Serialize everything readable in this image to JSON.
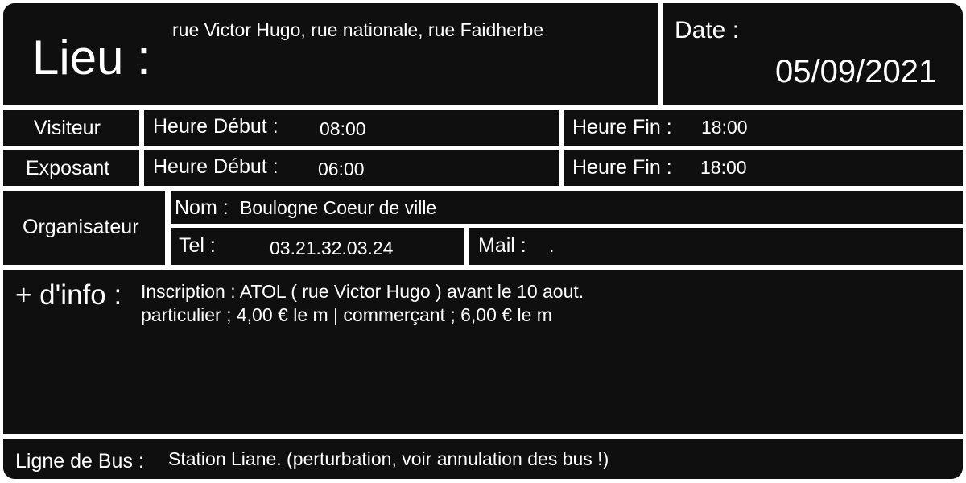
{
  "lieu": {
    "label": "Lieu :",
    "value": "rue Victor Hugo, rue nationale, rue Faidherbe"
  },
  "date": {
    "label": "Date :",
    "value": "05/09/2021"
  },
  "visiteur": {
    "label": "Visiteur",
    "debut_label": "Heure Début :",
    "debut_value": "08:00",
    "fin_label": "Heure Fin :",
    "fin_value": "18:00"
  },
  "exposant": {
    "label": "Exposant",
    "debut_label": "Heure Début :",
    "debut_value": "06:00",
    "fin_label": "Heure Fin :",
    "fin_value": "18:00"
  },
  "organisateur": {
    "label": "Organisateur",
    "nom_label": "Nom :",
    "nom_value": "Boulogne Coeur de ville",
    "tel_label": "Tel :",
    "tel_value": "03.21.32.03.24",
    "mail_label": "Mail :",
    "mail_value": "."
  },
  "info": {
    "label": "+ d'info :",
    "line1": "Inscription : ATOL ( rue Victor Hugo ) avant le 10 aout.",
    "line2": "particulier ; 4,00 € le m | commerçant ; 6,00 € le m"
  },
  "bus": {
    "label": "Ligne de Bus :",
    "value": "Station Liane. (perturbation, voir annulation des bus !)"
  }
}
